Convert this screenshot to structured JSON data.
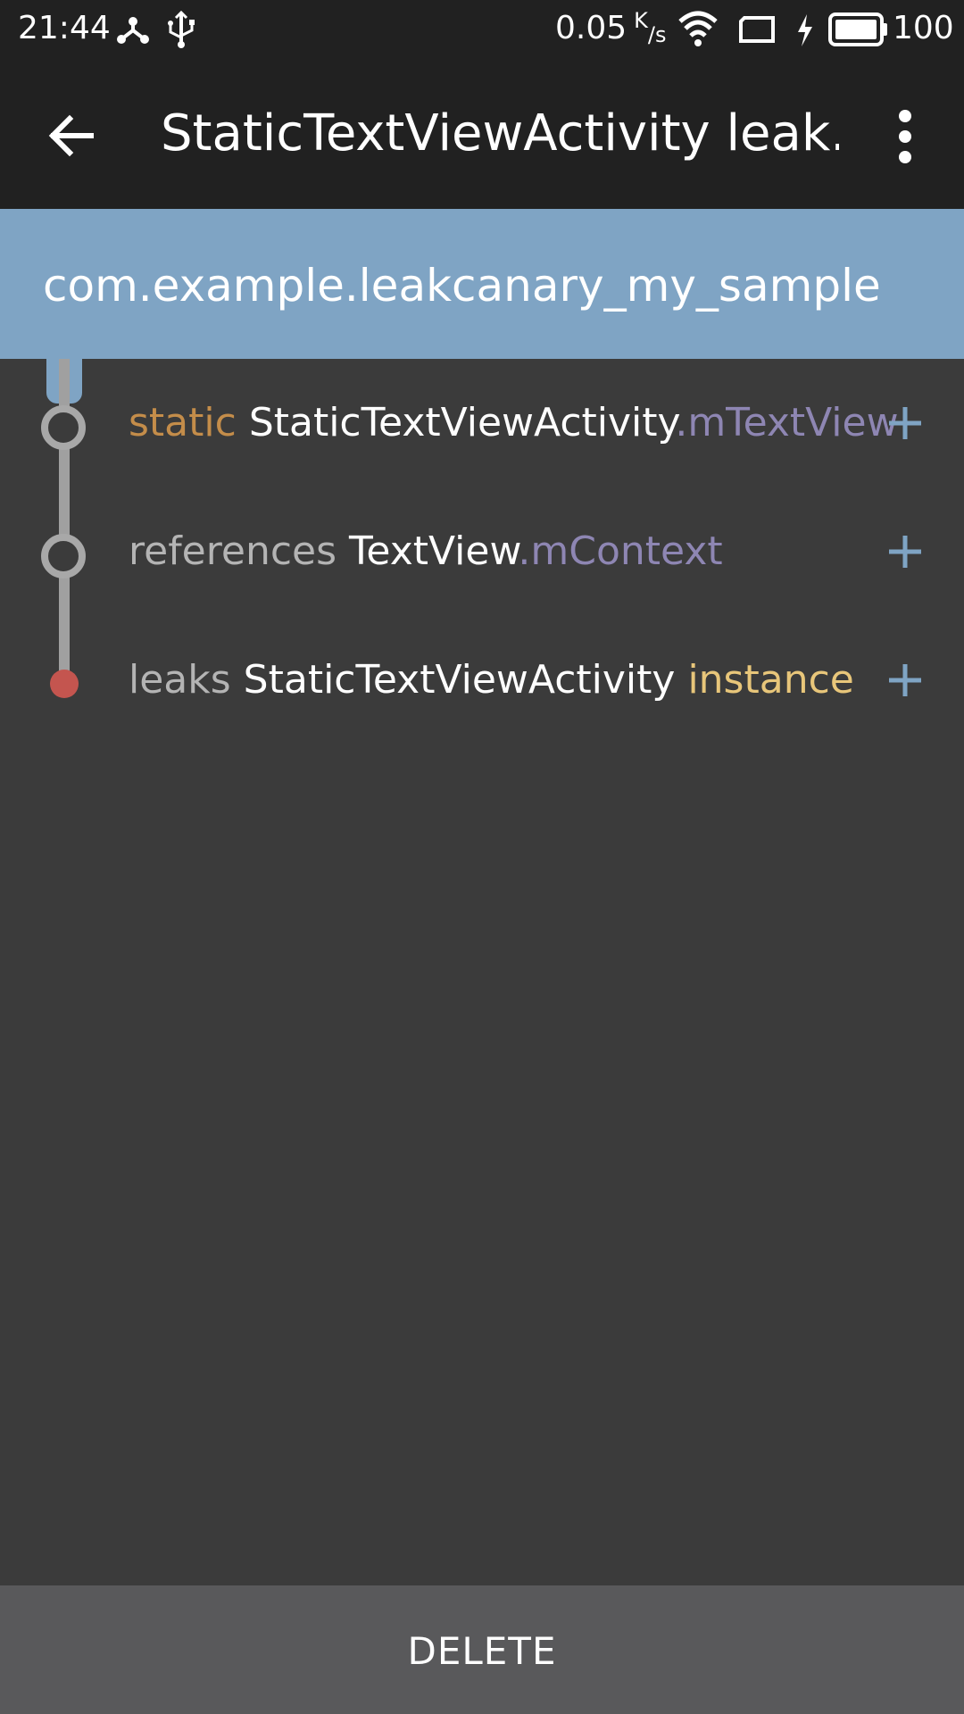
{
  "status_bar": {
    "time": "21:44",
    "net_speed": "0.05",
    "net_speed_unit_top": "K",
    "net_speed_unit_bottom": "/s",
    "battery_level": "100",
    "icons": [
      "share-icon",
      "usb-icon",
      "wifi-icon",
      "screen-icon",
      "charging-icon",
      "battery-icon"
    ]
  },
  "app_bar": {
    "title": "StaticTextViewActivity leak..",
    "icons": [
      "back-arrow-icon",
      "overflow-menu-icon"
    ]
  },
  "header": {
    "package_name": "com.example.leakcanary_my_sample",
    "color": "#7fa4c4"
  },
  "trace": [
    {
      "prefix": "static",
      "class_name": "StaticTextViewActivity",
      "separator": ".",
      "suffix": "mTextView",
      "node": "ring",
      "action_icon": "plus-icon"
    },
    {
      "prefix": "references",
      "class_name": "TextView",
      "separator": ".",
      "suffix": "mContext",
      "node": "ring",
      "action_icon": "plus-icon"
    },
    {
      "prefix": "leaks",
      "class_name": "StaticTextViewActivity",
      "separator": "",
      "suffix": "instance",
      "node": "leak",
      "action_icon": "plus-icon"
    }
  ],
  "footer": {
    "delete_label": "DELETE"
  },
  "colors": {
    "background": "#3b3b3b",
    "app_bar": "#212121",
    "keyword_static": "#c48d4a",
    "keyword_muted": "#b4b4b4",
    "field": "#8e86b3",
    "instance": "#e8c67a",
    "leak_node": "#c4554f",
    "plus_icon": "#7fa4c4",
    "footer": "#59595b"
  }
}
